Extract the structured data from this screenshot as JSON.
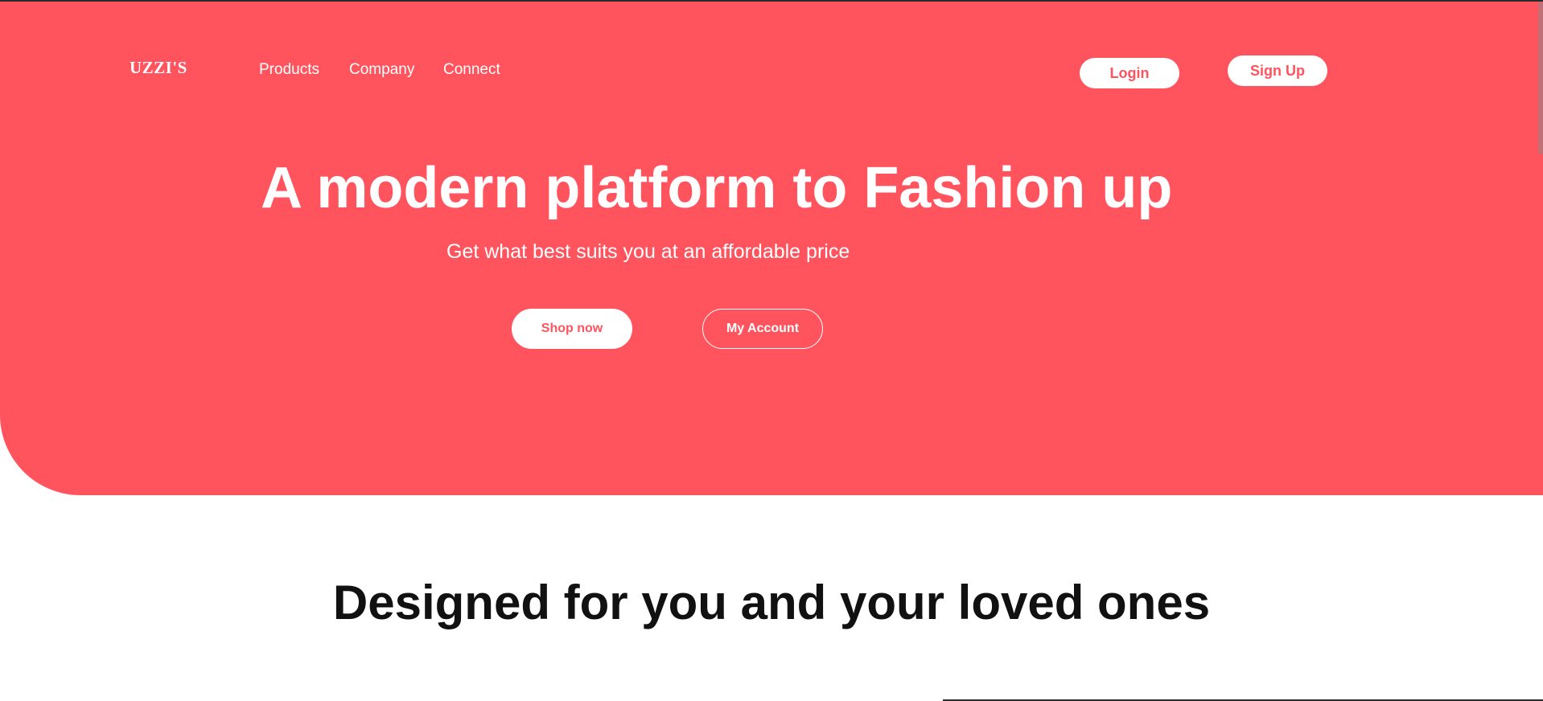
{
  "brand": {
    "logo": "UZZI'S",
    "accent_color": "#ff535d"
  },
  "nav": {
    "products": "Products",
    "company": "Company",
    "connect": "Connect"
  },
  "auth": {
    "login_label": "Login",
    "signup_label": "Sign Up"
  },
  "hero": {
    "title": "A modern platform to Fashion up",
    "subtitle": "Get what best suits you at an affordable price",
    "shop_label": "Shop now",
    "account_label": "My Account"
  },
  "section": {
    "title": "Designed for you and your loved ones"
  }
}
